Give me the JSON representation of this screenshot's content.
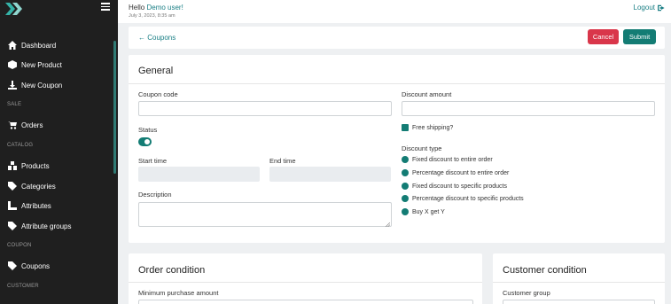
{
  "sidebar": {
    "items": [
      {
        "label": "Dashboard",
        "icon": "home-icon"
      },
      {
        "label": "New Product",
        "icon": "box-icon"
      },
      {
        "label": "New Coupon",
        "icon": "download-icon"
      },
      {
        "label": "Orders",
        "icon": "cart-icon"
      },
      {
        "label": "Products",
        "icon": "boxes-icon"
      },
      {
        "label": "Categories",
        "icon": "tag-icon"
      },
      {
        "label": "Attributes",
        "icon": "attributes-icon"
      },
      {
        "label": "Attribute groups",
        "icon": "tag-icon"
      },
      {
        "label": "Coupons",
        "icon": "tag-icon"
      }
    ],
    "sections": {
      "sale": "SALE",
      "catalog": "CATALOG",
      "coupon": "COUPON",
      "customer": "CUSTOMER"
    }
  },
  "topbar": {
    "hello": "Hello",
    "user": "Demo user!",
    "date": "July 3, 2023, 8:35 am",
    "logout": "Logout"
  },
  "actions": {
    "back": "← Coupons",
    "cancel": "Cancel",
    "submit": "Submit"
  },
  "general": {
    "title": "General",
    "coupon_code_label": "Coupon code",
    "coupon_code_value": "",
    "status_label": "Status",
    "status_on": true,
    "start_time_label": "Start time",
    "end_time_label": "End time",
    "description_label": "Description",
    "discount_amount_label": "Discount amount",
    "free_shipping_label": "Free shipping?",
    "discount_type_label": "Discount type",
    "discount_types": [
      "Fixed discount to entire order",
      "Percentage discount to entire order",
      "Fixed discount to specific products",
      "Percentage discount to specific products",
      "Buy X get Y"
    ]
  },
  "order_condition": {
    "title": "Order condition",
    "min_purchase_label": "Minimum purchase amount"
  },
  "customer_condition": {
    "title": "Customer condition",
    "customer_group_label": "Customer group"
  },
  "colors": {
    "accent": "#137c74",
    "link": "#1a7f85",
    "danger": "#d9364a",
    "sidebar": "#1f1f1f"
  }
}
